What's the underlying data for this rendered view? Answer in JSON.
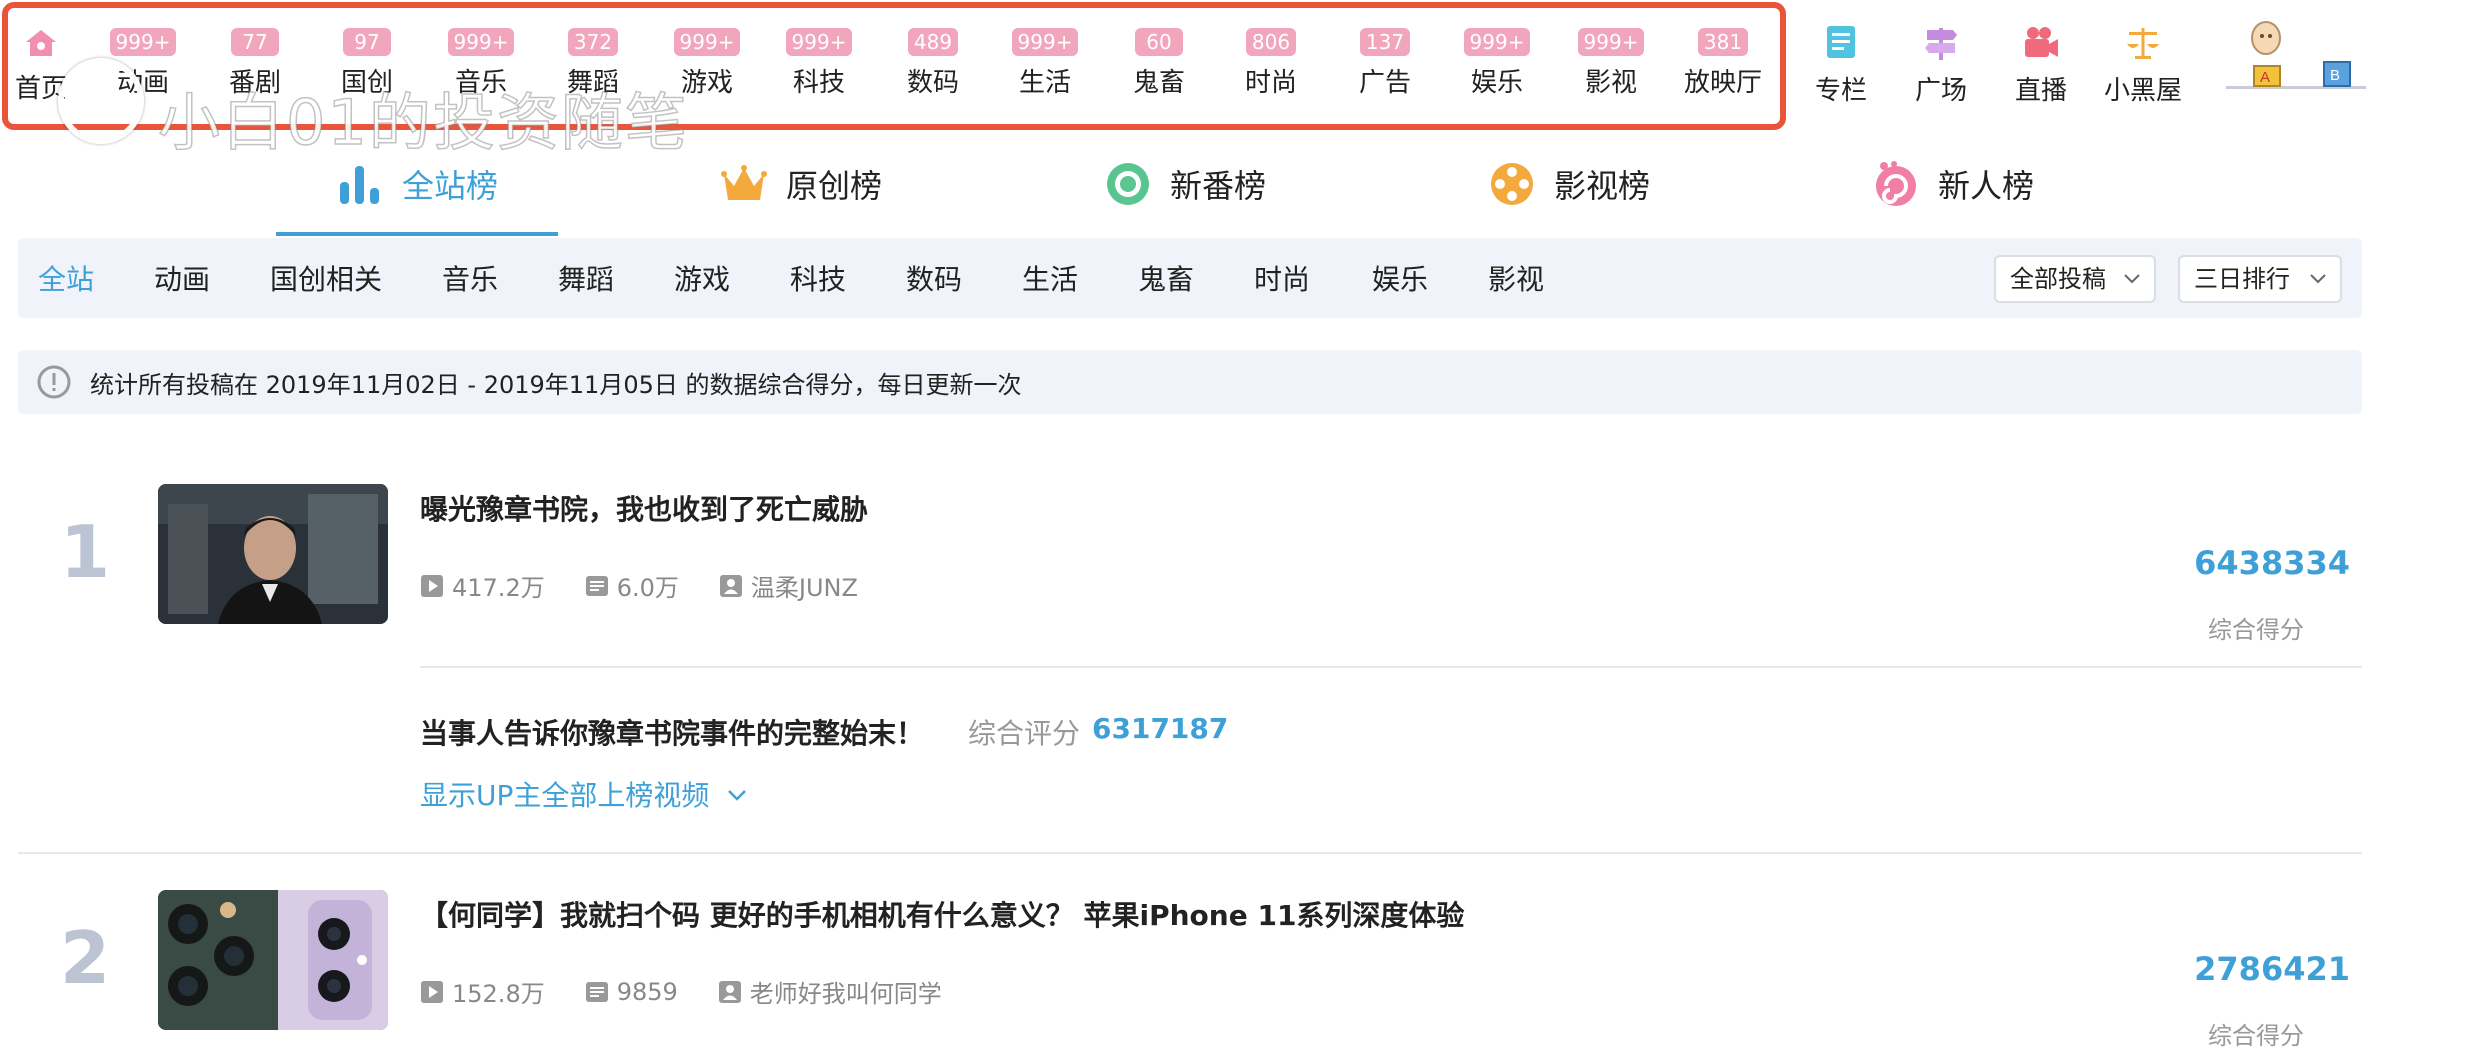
{
  "topnav": {
    "items": [
      {
        "label": "首页",
        "badge": ""
      },
      {
        "label": "动画",
        "badge": "999+"
      },
      {
        "label": "番剧",
        "badge": "77"
      },
      {
        "label": "国创",
        "badge": "97"
      },
      {
        "label": "音乐",
        "badge": "999+"
      },
      {
        "label": "舞蹈",
        "badge": "372"
      },
      {
        "label": "游戏",
        "badge": "999+"
      },
      {
        "label": "科技",
        "badge": "999+"
      },
      {
        "label": "数码",
        "badge": "489"
      },
      {
        "label": "生活",
        "badge": "999+"
      },
      {
        "label": "鬼畜",
        "badge": "60"
      },
      {
        "label": "时尚",
        "badge": "806"
      },
      {
        "label": "广告",
        "badge": "137"
      },
      {
        "label": "娱乐",
        "badge": "999+"
      },
      {
        "label": "影视",
        "badge": "999+"
      },
      {
        "label": "放映厅",
        "badge": "381"
      }
    ],
    "side_items": [
      {
        "label": "专栏",
        "icon": "column-icon"
      },
      {
        "label": "广场",
        "icon": "signpost-icon"
      },
      {
        "label": "直播",
        "icon": "live-camera-icon"
      },
      {
        "label": "小黑屋",
        "icon": "scales-icon"
      }
    ],
    "blackhouse": {
      "block_a": "A",
      "block_b": "B"
    },
    "highlight_color": "#e8553a"
  },
  "watermark": {
    "text": "小白01的投资随笔"
  },
  "rank_tabs": [
    {
      "label": "全站榜",
      "icon": "bar-chart-icon",
      "active": true
    },
    {
      "label": "原创榜",
      "icon": "crown-icon",
      "active": false
    },
    {
      "label": "新番榜",
      "icon": "ring-icon",
      "active": false
    },
    {
      "label": "影视榜",
      "icon": "film-reel-icon",
      "active": false
    },
    {
      "label": "新人榜",
      "icon": "swirl-icon",
      "active": false
    }
  ],
  "filters": {
    "categories": [
      "全站",
      "动画",
      "国创相关",
      "音乐",
      "舞蹈",
      "游戏",
      "科技",
      "数码",
      "生活",
      "鬼畜",
      "时尚",
      "娱乐",
      "影视"
    ],
    "select_type": "全部投稿",
    "select_range": "三日排行"
  },
  "notice": {
    "text": "统计所有投稿在 2019年11月02日 - 2019年11月05日 的数据综合得分，每日更新一次"
  },
  "rankings": [
    {
      "rank": "1",
      "title": "曝光豫章书院，我也收到了死亡威胁",
      "plays": "417.2万",
      "danmaku": "6.0万",
      "uploader": "温柔JUNZ",
      "score": "6438334",
      "score_label": "综合得分",
      "related": {
        "title": "当事人告诉你豫章书院事件的完整始末！",
        "score_label": "综合评分",
        "score": "6317187"
      },
      "show_more": "显示UP主全部上榜视频"
    },
    {
      "rank": "2",
      "title": "【何同学】我就扫个码 更好的手机相机有什么意义？ 苹果iPhone 11系列深度体验",
      "plays": "152.8万",
      "danmaku": "9859",
      "uploader": "老师好我叫何同学",
      "score": "2786421",
      "score_label": "综合得分"
    }
  ],
  "colors": {
    "accent": "#3fa0d8",
    "badge": "#f2a6bd",
    "rank_num": "#bcc4d3"
  }
}
